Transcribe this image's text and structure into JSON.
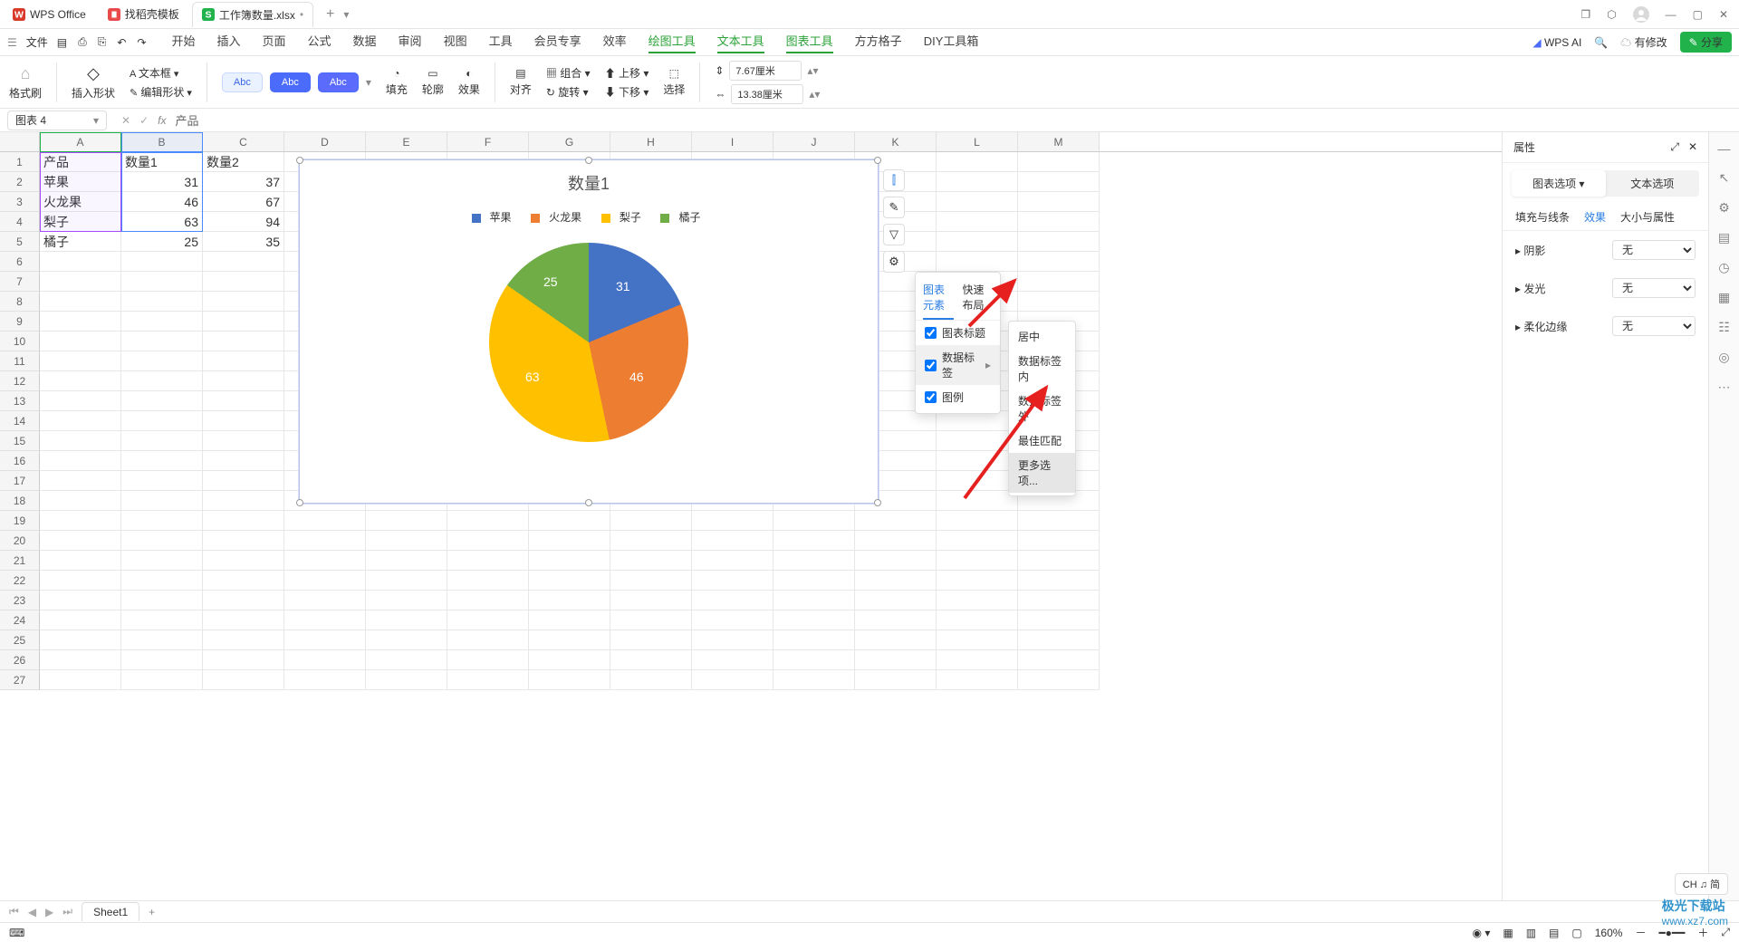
{
  "titlebar": {
    "tabs": [
      {
        "icon": "wps-logo",
        "label": "WPS Office"
      },
      {
        "icon": "doc-red",
        "label": "找稻壳模板"
      },
      {
        "icon": "sheet-green",
        "label": "工作簿数量.xlsx",
        "active": true
      }
    ]
  },
  "menus": {
    "file": "文件",
    "items": [
      "开始",
      "插入",
      "页面",
      "公式",
      "数据",
      "审阅",
      "视图",
      "工具",
      "会员专享",
      "效率",
      "绘图工具",
      "文本工具",
      "图表工具",
      "方方格子",
      "DIY工具箱"
    ],
    "active": [
      10,
      11,
      12
    ],
    "wpsai": "WPS AI",
    "modify": "有修改",
    "share": "分享"
  },
  "ribbon": {
    "format": "格式刷",
    "insertShape": "插入形状",
    "textbox": "文本框",
    "editShape": "编辑形状",
    "abc": "Abc",
    "fill": "填充",
    "outline": "轮廓",
    "effect": "效果",
    "align": "对齐",
    "group": "组合",
    "rotate": "旋转",
    "up": "上移",
    "down": "下移",
    "select": "选择",
    "w": "7.67厘米",
    "h": "13.38厘米"
  },
  "namebox": {
    "name": "图表 4",
    "formula": "产品"
  },
  "columns": [
    "A",
    "B",
    "C",
    "D",
    "E",
    "F",
    "G",
    "H",
    "I",
    "J",
    "K",
    "L",
    "M"
  ],
  "table": {
    "headers": [
      "产品",
      "数量1",
      "数量2"
    ],
    "rows": [
      [
        "苹果",
        "31",
        "37"
      ],
      [
        "火龙果",
        "46",
        "67"
      ],
      [
        "梨子",
        "63",
        "94"
      ],
      [
        "橘子",
        "25",
        "35"
      ]
    ]
  },
  "chart_data": {
    "type": "pie",
    "title": "数量1",
    "categories": [
      "苹果",
      "火龙果",
      "梨子",
      "橘子"
    ],
    "values": [
      31,
      46,
      63,
      25
    ],
    "colors": [
      "#4472c4",
      "#ed7d31",
      "#ffc000",
      "#70ad47"
    ]
  },
  "popup1": {
    "tab1": "图表元素",
    "tab2": "快速布局",
    "items": [
      "图表标题",
      "数据标签",
      "图例"
    ]
  },
  "popup2": {
    "items": [
      "居中",
      "数据标签内",
      "数据标签外",
      "最佳匹配",
      "更多选项..."
    ]
  },
  "rightpane": {
    "title": "属性",
    "tab1": "图表选项",
    "tab2": "文本选项",
    "sub": [
      "填充与线条",
      "效果",
      "大小与属性"
    ],
    "shadow": "阴影",
    "glow": "发光",
    "soft": "柔化边缘",
    "none": "无"
  },
  "sheetTab": "Sheet1",
  "status": {
    "zoom": "160%",
    "ime": "CH ♫ 简"
  },
  "watermark": {
    "brand": "极光下载站",
    "url": "www.xz7.com"
  }
}
